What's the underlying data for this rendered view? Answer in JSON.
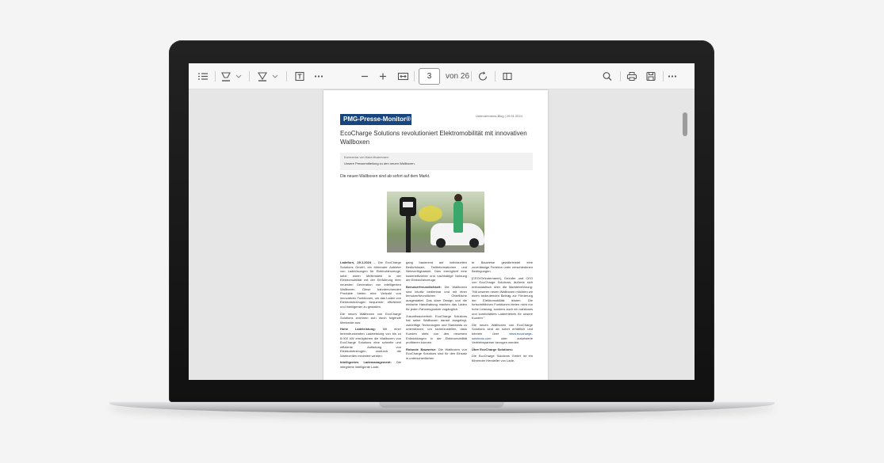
{
  "toolbar": {
    "current_page": "3",
    "page_of": "von 26",
    "icons": [
      "list-icon",
      "highlight-icon",
      "chevron-down-icon",
      "draw-icon",
      "chevron-down-icon",
      "text-box-icon",
      "more-icon",
      "zoom-out-icon",
      "zoom-in-icon",
      "fit-page-icon",
      "rotate-icon",
      "page-view-icon",
      "search-icon",
      "print-icon",
      "save-icon",
      "more-icon"
    ]
  },
  "document": {
    "logo": "PMG-Presse-Monitor®",
    "blog_meta": "Unternehmens-Blog | 29.01.2024",
    "headline": "EcoCharge Solutions revolutioniert Elektromobilität mit innovativen Wallboxen",
    "comment_author": "Kommentar von Maria Mustermann",
    "comment_text": "Unsere Pressemitteilung zu den neuen Wallboxen.",
    "lead": "Die neuen Wallboxen sind ab sofort auf dem Markt.",
    "col1": {
      "p1_bold": "Ladeforn, 29.1.2024",
      "p1": " – Die EcoCharge Solutions GmbH, ein führender Anbieter von Ladelösungen für Elektrofahrzeuge, setzt einen Meilenstein in der Elektromobilität mit der Einführung ihrer neuesten Generation von intelligenten Wallboxen. Diese bahnbrechenden Produkte bieten eine Vielzahl von innovativen Funktionen, um das Laden von Elektrofahrzeugen bequemer, effizienter und intelligenter zu gestalten.",
      "p2": "Die neuen Wallboxen von EcoCharge Solutions zeichnen sich durch folgende Merkmale aus:",
      "p3_bold": "Hohe Ladeleistung:",
      "p3": " Mit einer beeindruckenden Ladeleistung von bis zu 8.000 kW ermöglichen die Wallboxen von EcoCharge Solutions eine schnelle und effiziente Aufladung von Elektrofahrzeugen, wodurch die Wartezeiten minimiert werden.",
      "p4_bold": "Intelligentes Lademanagement:",
      "p4": " Die integrierte intelligente Lade-"
    },
    "col2": {
      "p1": "gang basierend auf individuellen Bedürfnissen, Tarifinformationen und Netzverfügbarkeit. Dies ermöglicht eine kosteneffiziente und nachhaltige Nutzung der Elektrofahrzeuge.",
      "p2_bold": "Benutzerfreundlichkeit:",
      "p2": " Die Wallboxen sind intuitiv bedienbar und mit einer benutzerfreundlichen Oberfläche ausgestattet. Das klare Design und die einfache Handhabung machen das Laden für jeden Fahrzeugnutzer zugänglich.",
      "p3": "Zukunftssicherheit: EcoCharge Solutions hat seine Wallboxen darauf ausgelegt, zukünftige Technologien und Standards zu unterstützen, um sicherzustellen, dass Kunden stets von den neuesten Entwicklungen in der Elektromobilität profitieren können.",
      "p4_bold": "Robuste Bauweise:",
      "p4": " Die Wallboxen von EcoCharge Solutions sind für den Einsatz in unterschiedlichen"
    },
    "col3": {
      "p1": "te Bauweise gewährleistet eine zuverlässige Funktion unter verschiedenen Bedingungen.",
      "p2": "[CEO/Gründername], Gründer und CEO von EcoCharge Solutions, äußerte sich enthusiastisch über die Markteinführung: \"Mit unseren neuen Wallboxen möchten wir einen bedeutenden Beitrag zur Förderung der Elektromobilität leisten. Die fortschrittlichen Funktionen bieten nicht nur hohe Leistung, sondern auch ein nahtloses und komfortables Ladeerlebnis für unsere Kunden.\"",
      "p3": "Die neuen Wallboxen von EcoCharge Solutions sind ab sofort erhältlich und können über ",
      "p3_link": "www.ecocharge-solutions.com",
      "p3_end": " oder autorisierte Vertriebspartner bezogen werden.",
      "p4_bold": "Über EcoCharge Solutions:",
      "p5": "Die EcoCharge Solutions GmbH ist ein führender Hersteller von Lade-"
    }
  }
}
